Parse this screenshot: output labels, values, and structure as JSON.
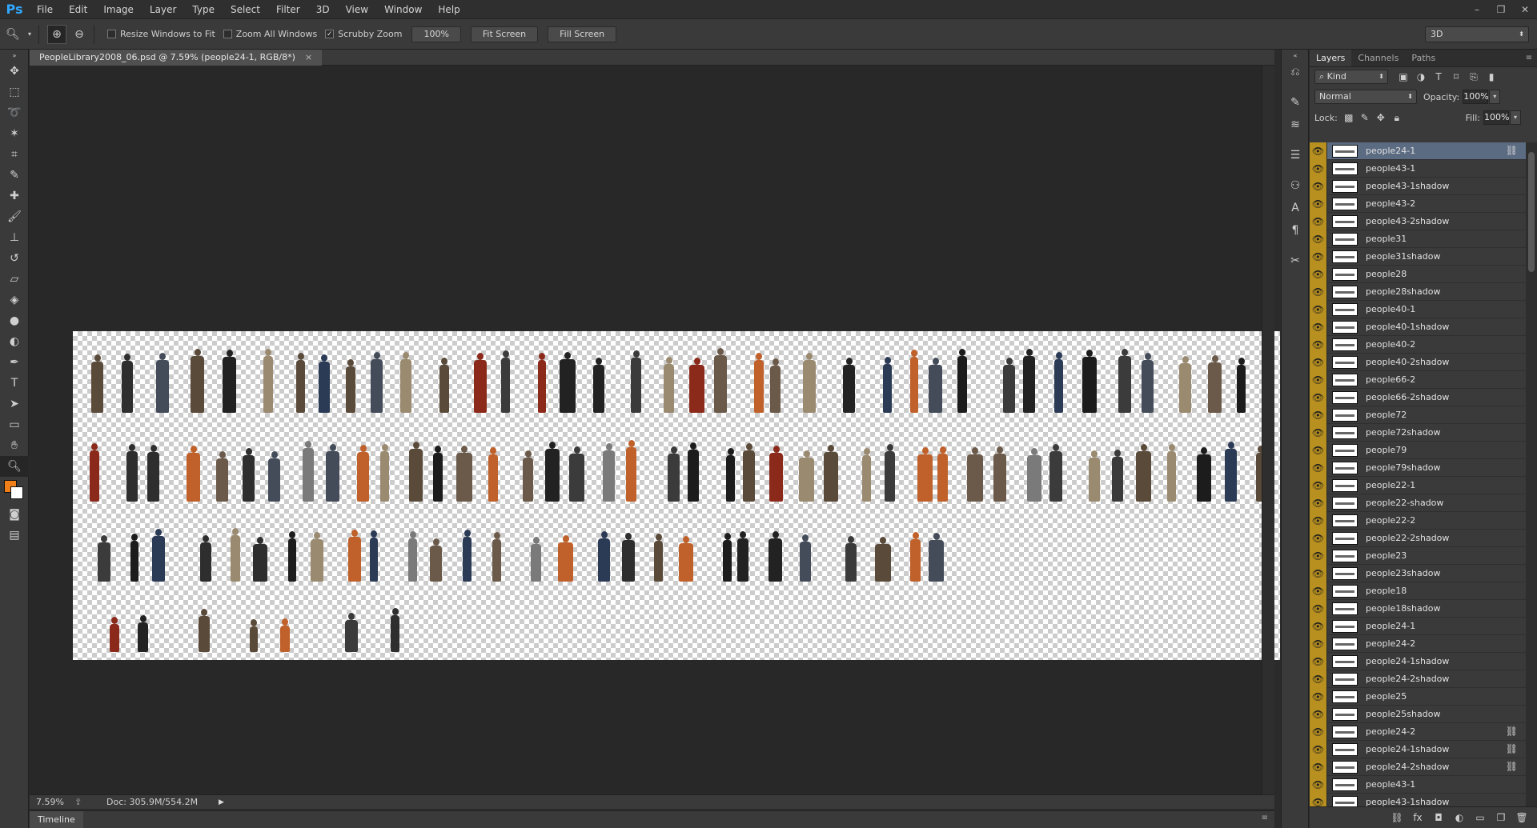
{
  "app": {
    "logo": "Ps"
  },
  "menu": [
    "File",
    "Edit",
    "Image",
    "Layer",
    "Type",
    "Select",
    "Filter",
    "3D",
    "View",
    "Window",
    "Help"
  ],
  "window_controls": {
    "minimize": "–",
    "restore": "❐",
    "close": "✕"
  },
  "options": {
    "tool_icon": "zoom-icon",
    "resize_windows": "Resize Windows to Fit",
    "zoom_all": "Zoom All Windows",
    "scrubby_zoom": "Scrubby Zoom",
    "scrubby_checked": "✓",
    "btn_100": "100%",
    "btn_fit": "Fit Screen",
    "btn_fill": "Fill Screen",
    "workspace": "3D"
  },
  "document": {
    "tab_title": "PeopleLibrary2008_06.psd @ 7.59% (people24-1, RGB/8*)",
    "tab_close": "×"
  },
  "status": {
    "zoom": "7.59%",
    "doc": "Doc: 305.9M/554.2M",
    "more": "▶"
  },
  "timeline": {
    "label": "Timeline"
  },
  "layers_panel": {
    "tabs": [
      "Layers",
      "Channels",
      "Paths"
    ],
    "kind": "Kind",
    "blend": "Normal",
    "opacity_label": "Opacity:",
    "opacity": "100%",
    "lock_label": "Lock:",
    "fill_label": "Fill:",
    "fill": "100%",
    "layers": [
      {
        "name": "people24-1",
        "selected": true,
        "linked": true
      },
      {
        "name": "people43-1",
        "selected": false,
        "linked": false
      },
      {
        "name": "people43-1shadow",
        "selected": false,
        "linked": false
      },
      {
        "name": "people43-2",
        "selected": false,
        "linked": false
      },
      {
        "name": "people43-2shadow",
        "selected": false,
        "linked": false
      },
      {
        "name": "people31",
        "selected": false,
        "linked": false
      },
      {
        "name": "people31shadow",
        "selected": false,
        "linked": false
      },
      {
        "name": "people28",
        "selected": false,
        "linked": false
      },
      {
        "name": "people28shadow",
        "selected": false,
        "linked": false
      },
      {
        "name": "people40-1",
        "selected": false,
        "linked": false
      },
      {
        "name": "people40-1shadow",
        "selected": false,
        "linked": false
      },
      {
        "name": "people40-2",
        "selected": false,
        "linked": false
      },
      {
        "name": "people40-2shadow",
        "selected": false,
        "linked": false
      },
      {
        "name": "people66-2",
        "selected": false,
        "linked": false
      },
      {
        "name": "people66-2shadow",
        "selected": false,
        "linked": false
      },
      {
        "name": "people72",
        "selected": false,
        "linked": false
      },
      {
        "name": "people72shadow",
        "selected": false,
        "linked": false
      },
      {
        "name": "people79",
        "selected": false,
        "linked": false
      },
      {
        "name": "people79shadow",
        "selected": false,
        "linked": false
      },
      {
        "name": "people22-1",
        "selected": false,
        "linked": false
      },
      {
        "name": "people22-shadow",
        "selected": false,
        "linked": false
      },
      {
        "name": "people22-2",
        "selected": false,
        "linked": false
      },
      {
        "name": "people22-2shadow",
        "selected": false,
        "linked": false
      },
      {
        "name": "people23",
        "selected": false,
        "linked": false
      },
      {
        "name": "people23shadow",
        "selected": false,
        "linked": false
      },
      {
        "name": "people18",
        "selected": false,
        "linked": false
      },
      {
        "name": "people18shadow",
        "selected": false,
        "linked": false
      },
      {
        "name": "people24-1",
        "selected": false,
        "linked": false
      },
      {
        "name": "people24-2",
        "selected": false,
        "linked": false
      },
      {
        "name": "people24-1shadow",
        "selected": false,
        "linked": false
      },
      {
        "name": "people24-2shadow",
        "selected": false,
        "linked": false
      },
      {
        "name": "people25",
        "selected": false,
        "linked": false
      },
      {
        "name": "people25shadow",
        "selected": false,
        "linked": false
      },
      {
        "name": "people24-2",
        "selected": false,
        "linked": true
      },
      {
        "name": "people24-1shadow",
        "selected": false,
        "linked": true
      },
      {
        "name": "people24-2shadow",
        "selected": false,
        "linked": true
      },
      {
        "name": "people43-1",
        "selected": false,
        "linked": false
      },
      {
        "name": "people43-1shadow",
        "selected": false,
        "linked": false
      }
    ]
  },
  "colors": {
    "foreground": "#f07f19",
    "background": "#ffffff",
    "eye_column": "#b8901f",
    "selected_layer": "#5b6b82"
  }
}
